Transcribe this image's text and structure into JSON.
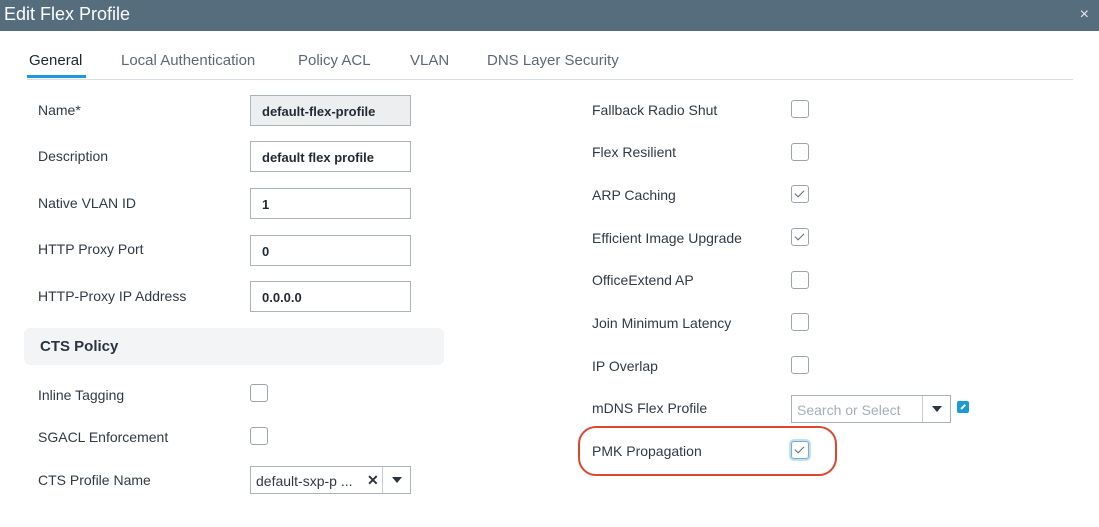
{
  "window": {
    "title": "Edit Flex Profile",
    "close_glyph": "×"
  },
  "tabs": [
    {
      "label": "General",
      "active": true
    },
    {
      "label": "Local Authentication",
      "active": false
    },
    {
      "label": "Policy ACL",
      "active": false
    },
    {
      "label": "VLAN",
      "active": false
    },
    {
      "label": "DNS Layer Security",
      "active": false
    }
  ],
  "left": {
    "name": {
      "label": "Name*",
      "value": "default-flex-profile"
    },
    "description": {
      "label": "Description",
      "value": "default flex profile"
    },
    "native_vlan": {
      "label": "Native VLAN ID",
      "value": "1"
    },
    "http_proxy_port": {
      "label": "HTTP Proxy Port",
      "value": "0"
    },
    "http_proxy_ip": {
      "label": "HTTP-Proxy IP Address",
      "value": "0.0.0.0"
    },
    "cts_section_title": "CTS Policy",
    "inline_tagging": {
      "label": "Inline Tagging",
      "checked": false
    },
    "sgacl_enforcement": {
      "label": "SGACL Enforcement",
      "checked": false
    },
    "cts_profile_name": {
      "label": "CTS Profile Name",
      "value": "default-sxp-p ...",
      "clear_glyph": "✕"
    }
  },
  "right": {
    "fallback_radio_shut": {
      "label": "Fallback Radio Shut",
      "checked": false
    },
    "flex_resilient": {
      "label": "Flex Resilient",
      "checked": false
    },
    "arp_caching": {
      "label": "ARP Caching",
      "checked": true
    },
    "efficient_image_upgrade": {
      "label": "Efficient Image Upgrade",
      "checked": true
    },
    "officeextend_ap": {
      "label": "OfficeExtend AP",
      "checked": false
    },
    "join_minimum_latency": {
      "label": "Join Minimum Latency",
      "checked": false
    },
    "ip_overlap": {
      "label": "IP Overlap",
      "checked": false
    },
    "mdns_flex_profile": {
      "label": "mDNS Flex Profile",
      "placeholder": "Search or Select"
    },
    "pmk_propagation": {
      "label": "PMK Propagation",
      "checked": true,
      "highlighted": true
    }
  },
  "colors": {
    "title_bar": "#566d7e",
    "accent": "#1a9bd7",
    "highlight": "#e0452d"
  },
  "icons": {
    "close": "close-icon",
    "external_link": "external-link-icon",
    "dropdown": "chevron-down-icon"
  }
}
